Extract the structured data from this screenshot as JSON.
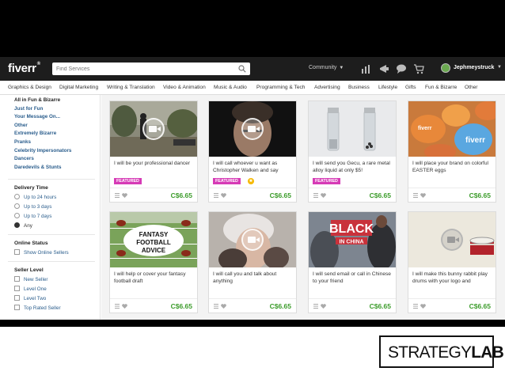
{
  "header": {
    "logo": "fiverr",
    "search_placeholder": "Find Services",
    "community": "Community",
    "username": "Jephmeystruck"
  },
  "categories": [
    "Graphics & Design",
    "Digital Marketing",
    "Writing & Translation",
    "Video & Animation",
    "Music & Audio",
    "Programming & Tech",
    "Advertising",
    "Business",
    "Lifestyle",
    "Gifts",
    "Fun & Bizarre",
    "Other"
  ],
  "sidebar": {
    "category_links": [
      "All in Fun & Bizarre",
      "Just for Fun",
      "Your Message On...",
      "Other",
      "Extremely Bizarre",
      "Pranks",
      "Celebrity Impersonators",
      "Dancers",
      "Daredevils & Stunts"
    ],
    "delivery_title": "Delivery Time",
    "delivery_options": [
      "Up to 24 hours",
      "Up to 3 days",
      "Up to 7 days",
      "Any"
    ],
    "delivery_selected": "Any",
    "online_title": "Online Status",
    "online_option": "Show Online Sellers",
    "seller_title": "Seller Level",
    "seller_options": [
      "New Seller",
      "Level One",
      "Level Two",
      "Top Rated Seller"
    ]
  },
  "gigs": [
    {
      "desc": "I will be your professional dancer",
      "featured": "FEATURED",
      "price": "C$6.65"
    },
    {
      "desc": "I will call whoever u want as Christopher Walken and say",
      "featured": "FEATURED",
      "price": "C$6.65"
    },
    {
      "desc": "I will send you Gecu, a rare metal alloy liquid at only $5!",
      "featured": "FEATURED",
      "price": "C$6.65"
    },
    {
      "desc": "I will place your brand on colorful EASTER eggs",
      "price": "C$6.65"
    },
    {
      "desc": "I will help or cover your fantasy football draft",
      "price": "C$6.65"
    },
    {
      "desc": "I will call you and talk about anything",
      "price": "C$6.65"
    },
    {
      "desc": "I will send email or call in Chinese to your friend",
      "price": "C$6.65"
    },
    {
      "desc": "I will make this bunny rabbit play drums with your logo and",
      "price": "C$6.65"
    }
  ],
  "thumb_text": {
    "fantasy": "FANTASY FOOTBALL ADVICE",
    "black": "BLACK",
    "in_china": "IN CHINA",
    "eggs": "fiverr"
  },
  "strategylab": {
    "part1": "STRATEGY",
    "part2": "LAB"
  },
  "colors": {
    "price_green": "#3c9c2b",
    "featured_pink": "#d63bb6",
    "header_bg": "#1d1d1d",
    "link_blue": "#2a5d8c"
  }
}
